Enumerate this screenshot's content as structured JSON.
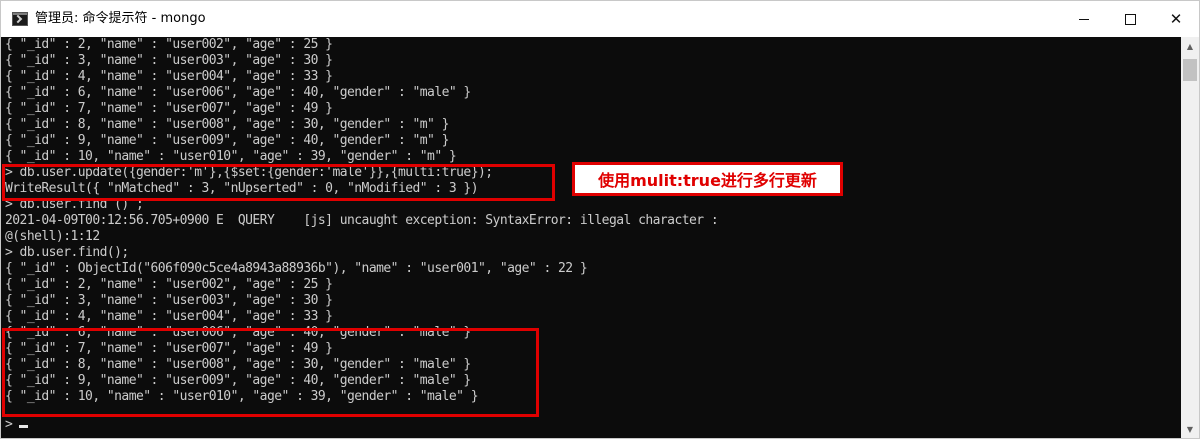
{
  "window": {
    "title": "管理员: 命令提示符 - mongo",
    "icon": "cmd-icon",
    "controls": [
      "minimize",
      "maximize",
      "close"
    ]
  },
  "console": {
    "lines": [
      "{ \"_id\" : 2, \"name\" : \"user002\", \"age\" : 25 }",
      "{ \"_id\" : 3, \"name\" : \"user003\", \"age\" : 30 }",
      "{ \"_id\" : 4, \"name\" : \"user004\", \"age\" : 33 }",
      "{ \"_id\" : 6, \"name\" : \"user006\", \"age\" : 40, \"gender\" : \"male\" }",
      "{ \"_id\" : 7, \"name\" : \"user007\", \"age\" : 49 }",
      "{ \"_id\" : 8, \"name\" : \"user008\", \"age\" : 30, \"gender\" : \"m\" }",
      "{ \"_id\" : 9, \"name\" : \"user009\", \"age\" : 40, \"gender\" : \"m\" }",
      "{ \"_id\" : 10, \"name\" : \"user010\", \"age\" : 39, \"gender\" : \"m\" }",
      "> db.user.update({gender:'m'},{$set:{gender:'male'}},{multi:true});",
      "WriteResult({ \"nMatched\" : 3, \"nUpserted\" : 0, \"nModified\" : 3 })",
      "> db.user.find () ;",
      "2021-04-09T00:12:56.705+0900 E  QUERY    [js] uncaught exception: SyntaxError: illegal character :",
      "@(shell):1:12",
      "> db.user.find();",
      "{ \"_id\" : ObjectId(\"606f090c5ce4a8943a88936b\"), \"name\" : \"user001\", \"age\" : 22 }",
      "{ \"_id\" : 2, \"name\" : \"user002\", \"age\" : 25 }",
      "{ \"_id\" : 3, \"name\" : \"user003\", \"age\" : 30 }",
      "{ \"_id\" : 4, \"name\" : \"user004\", \"age\" : 33 }",
      "{ \"_id\" : 6, \"name\" : \"user006\", \"age\" : 40, \"gender\" : \"male\" }",
      "{ \"_id\" : 7, \"name\" : \"user007\", \"age\" : 49 }",
      "{ \"_id\" : 8, \"name\" : \"user008\", \"age\" : 30, \"gender\" : \"male\" }",
      "{ \"_id\" : 9, \"name\" : \"user009\", \"age\" : 40, \"gender\" : \"male\" }",
      "{ \"_id\" : 10, \"name\" : \"user010\", \"age\" : 39, \"gender\" : \"male\" }",
      ">"
    ]
  },
  "annotation": {
    "callout_text": "使用mulit:true进行多行更新",
    "color": "#e00000"
  },
  "colors": {
    "console_bg": "#0c0c0c",
    "console_text": "#cccccc",
    "titlebar_bg": "#ffffff"
  }
}
